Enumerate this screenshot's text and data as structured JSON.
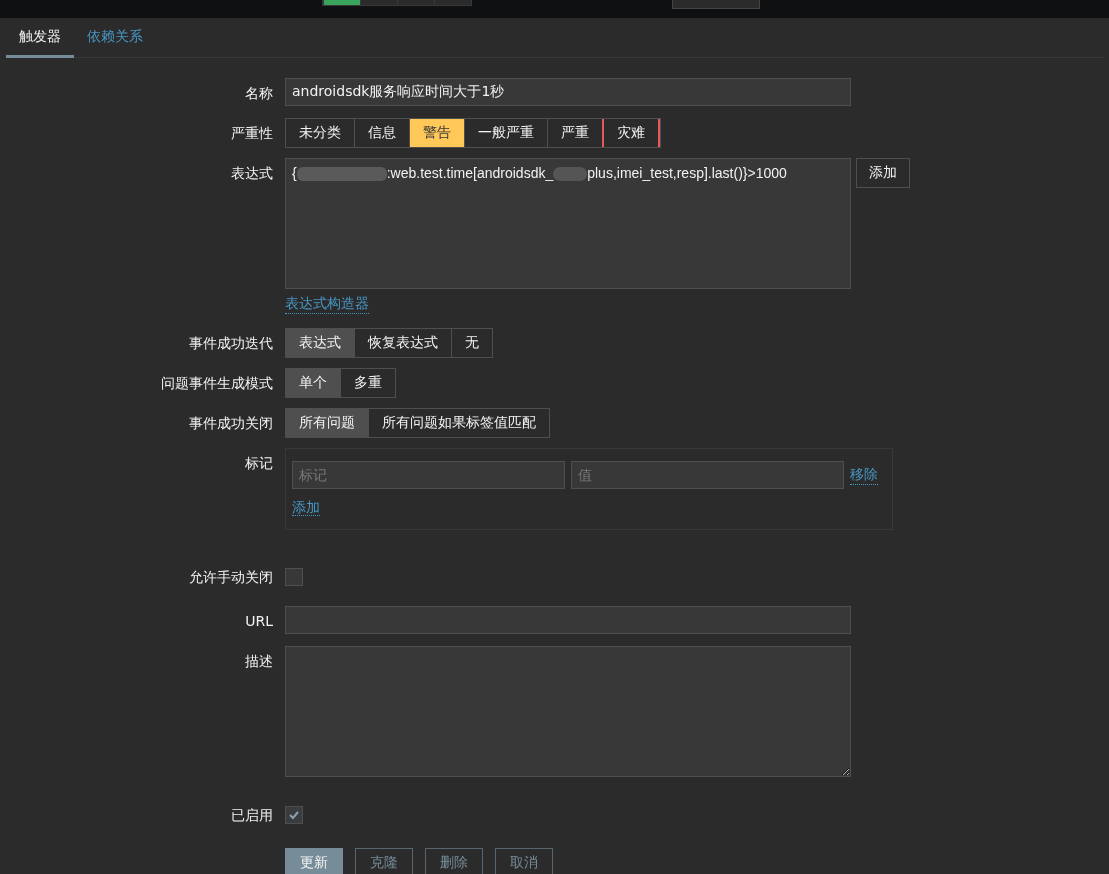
{
  "tabs": [
    {
      "label": "触发器",
      "selected": true
    },
    {
      "label": "依赖关系",
      "selected": false
    }
  ],
  "form": {
    "name": {
      "label": "名称",
      "value": "androidsdk服务响应时间大于1秒"
    },
    "severity": {
      "label": "严重性",
      "options": [
        {
          "label": "未分类",
          "selected": false
        },
        {
          "label": "信息",
          "selected": false
        },
        {
          "label": "警告",
          "selected": true
        },
        {
          "label": "一般严重",
          "selected": false
        },
        {
          "label": "严重",
          "selected": false
        },
        {
          "label": "灾难",
          "selected": false
        }
      ]
    },
    "expression": {
      "label": "表达式",
      "value_start": "{",
      "value_middle": ":web.test.time[androidsdk_",
      "value_end": "plus,imei_test,resp].last()}>1000",
      "add_button": "添加",
      "constructor_link": "表达式构造器"
    },
    "ok_event_generation": {
      "label": "事件成功迭代",
      "options": [
        {
          "label": "表达式",
          "selected": true
        },
        {
          "label": "恢复表达式",
          "selected": false
        },
        {
          "label": "无",
          "selected": false
        }
      ]
    },
    "problem_mode": {
      "label": "问题事件生成模式",
      "options": [
        {
          "label": "单个",
          "selected": true
        },
        {
          "label": "多重",
          "selected": false
        }
      ]
    },
    "ok_close": {
      "label": "事件成功关闭",
      "options": [
        {
          "label": "所有问题",
          "selected": true
        },
        {
          "label": "所有问题如果标签值匹配",
          "selected": false
        }
      ]
    },
    "tags": {
      "label": "标记",
      "rows": [
        {
          "tag_placeholder": "标记",
          "value_placeholder": "值",
          "remove": "移除"
        }
      ],
      "add": "添加"
    },
    "manual_close": {
      "label": "允许手动关闭",
      "checked": false
    },
    "url": {
      "label": "URL"
    },
    "description": {
      "label": "描述"
    },
    "enabled": {
      "label": "已启用",
      "checked": true
    }
  },
  "buttons": [
    {
      "label": "更新",
      "primary": true
    },
    {
      "label": "克隆",
      "primary": false
    },
    {
      "label": "删除",
      "primary": false
    },
    {
      "label": "取消",
      "primary": false
    }
  ]
}
